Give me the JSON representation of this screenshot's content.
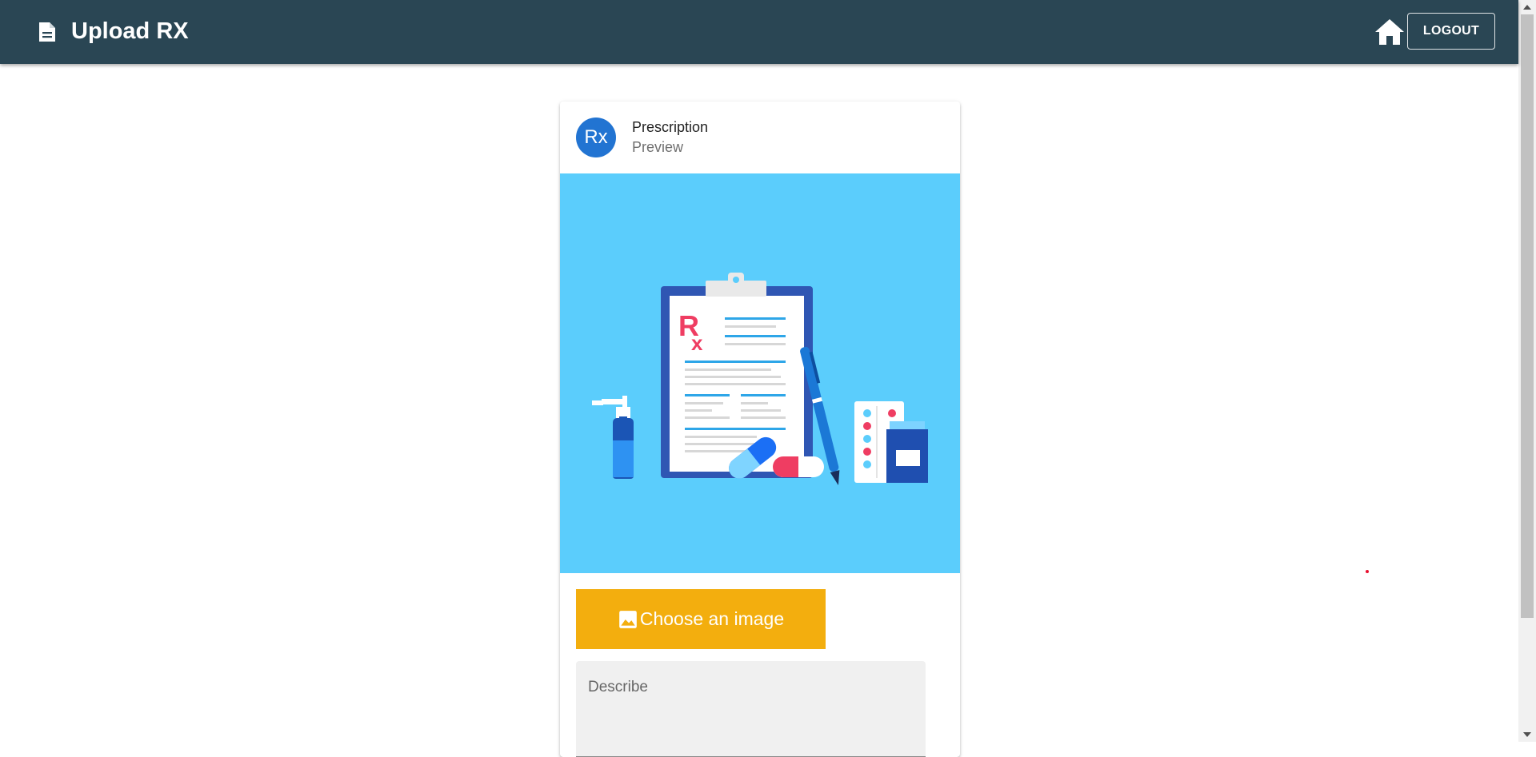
{
  "appbar": {
    "title": "Upload RX",
    "logout_label": "LOGOUT",
    "background": "#2a4654",
    "icons": {
      "title_icon": "description-icon",
      "home": "home-icon"
    }
  },
  "card": {
    "avatar_text": "Rx",
    "avatar_color": "#2274d2",
    "title": "Prescription",
    "subtitle": "Preview",
    "media_background": "#5bcdfc",
    "illustration_mark": "R",
    "illustration_mark_sub": "x"
  },
  "upload": {
    "choose_label": "Choose an image",
    "choose_color": "#f3ae0e",
    "choose_icon": "image-icon",
    "describe_placeholder": "Describe"
  }
}
